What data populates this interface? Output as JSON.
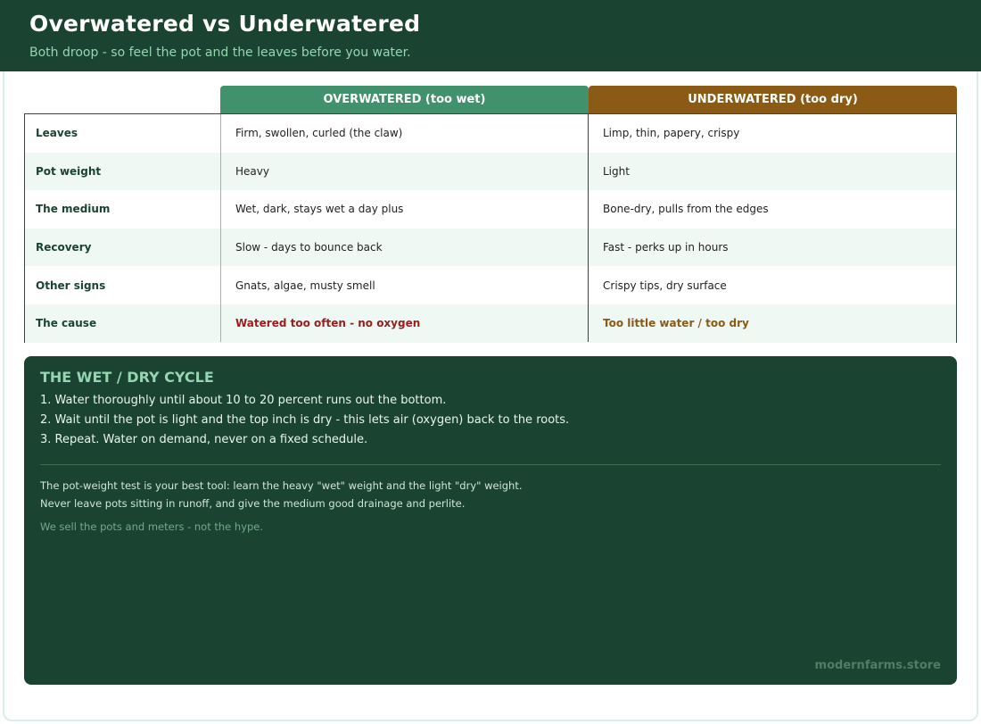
{
  "header": {
    "title": "Overwatered vs Underwatered",
    "subtitle": "Both droop - so feel the pot and the leaves before you water."
  },
  "columns": {
    "wet": "OVERWATERED (too wet)",
    "dry": "UNDERWATERED (too dry)"
  },
  "rows": [
    {
      "label": "Leaves",
      "wet": "Firm, swollen, curled (the claw)",
      "dry": "Limp, thin, papery, crispy"
    },
    {
      "label": "Pot weight",
      "wet": "Heavy",
      "dry": "Light"
    },
    {
      "label": "The medium",
      "wet": "Wet, dark, stays wet a day plus",
      "dry": "Bone-dry, pulls from the edges"
    },
    {
      "label": "Recovery",
      "wet": "Slow - days to bounce back",
      "dry": "Fast - perks up in hours"
    },
    {
      "label": "Other signs",
      "wet": "Gnats, algae, musty smell",
      "dry": "Crispy tips, dry surface"
    },
    {
      "label": "The cause",
      "wet": "Watered too often - no oxygen",
      "dry": "Too little water / too dry"
    }
  ],
  "cycle": {
    "title": "THE WET / DRY CYCLE",
    "steps": [
      "1. Water thoroughly until about 10 to 20 percent runs out the bottom.",
      "2. Wait until the pot is light and the top inch is dry - this lets air (oxygen) back to the roots.",
      "3. Repeat. Water on demand, never on a fixed schedule."
    ],
    "notes": [
      "The pot-weight test is your best tool: learn the heavy \"wet\" weight and the light \"dry\" weight.",
      "Never leave pots sitting in runoff, and give the medium good drainage and perlite."
    ],
    "tagline": "We sell the pots and meters - not the hype.",
    "site": "modernfarms.store"
  },
  "colors": {
    "dark_green": "#1b4332",
    "wet_header": "#40916c",
    "dry_header": "#8b5a14",
    "wet_emphasis": "#9b1c1c",
    "dry_emphasis": "#8b5a14"
  }
}
